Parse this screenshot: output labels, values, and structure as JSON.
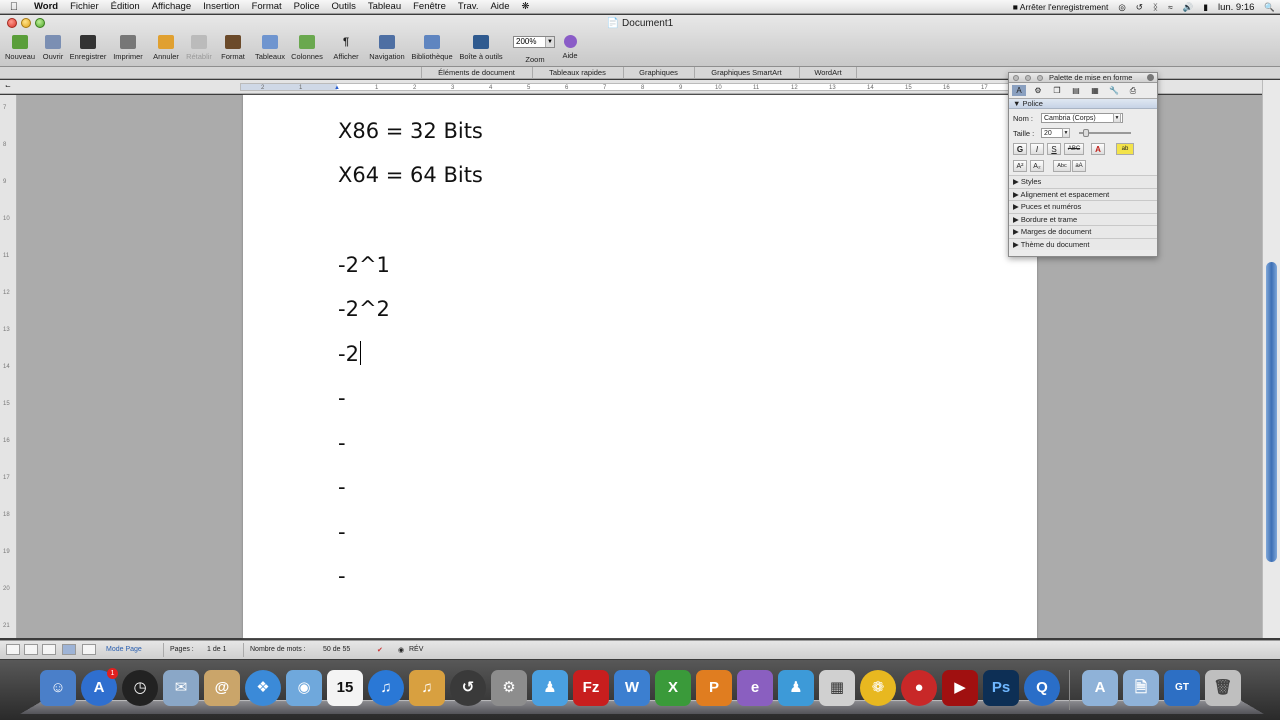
{
  "menubar": {
    "app": "Word",
    "items": [
      "Fichier",
      "Édition",
      "Affichage",
      "Insertion",
      "Format",
      "Police",
      "Outils",
      "Tableau",
      "Fenêtre",
      "Trav.",
      "Aide"
    ],
    "recording": "Arrêter l'enregistrement",
    "clock": "lun. 9:16"
  },
  "window": {
    "title": "Document1"
  },
  "toolbar": {
    "nouveau": "Nouveau",
    "ouvrir": "Ouvrir",
    "enregistrer": "Enregistrer",
    "imprimer": "Imprimer",
    "annuler": "Annuler",
    "retablir": "Rétablir",
    "format": "Format",
    "tableaux": "Tableaux",
    "colonnes": "Colonnes",
    "afficher": "Afficher",
    "navigation": "Navigation",
    "bibliotheque": "Bibliothèque",
    "boite": "Boîte à outils",
    "zoom_label": "Zoom",
    "zoom_value": "200%",
    "aide": "Aide"
  },
  "gallery": {
    "tabs": [
      "Éléments de document",
      "Tableaux rapides",
      "Graphiques",
      "Graphiques SmartArt",
      "WordArt"
    ]
  },
  "ruler": {
    "marks": [
      "2",
      "1",
      "1",
      "2",
      "3",
      "4",
      "5",
      "6",
      "7",
      "8",
      "9",
      "10",
      "11",
      "12",
      "13",
      "14",
      "15",
      "16",
      "17"
    ]
  },
  "vruler": {
    "marks": [
      "7",
      "8",
      "9",
      "10",
      "11",
      "12",
      "13",
      "14",
      "15",
      "16",
      "17",
      "18",
      "19",
      "20",
      "21"
    ]
  },
  "document": {
    "lines": [
      "X86 = 32 Bits",
      "X64 = 64 Bits",
      "-2^1",
      "-2^2",
      "-2",
      "-",
      "-",
      "-",
      "-",
      "-"
    ]
  },
  "palette": {
    "title": "Palette de mise en forme",
    "section_police": "Police",
    "nom_label": "Nom :",
    "nom_value": "Cambria (Corps)",
    "taille_label": "Taille :",
    "taille_value": "20",
    "bold": "G",
    "italic": "I",
    "strike": "S",
    "abc": "ABC",
    "sections": [
      "Styles",
      "Alignement et espacement",
      "Puces et numéros",
      "Bordure et trame",
      "Marges de document",
      "Thème du document"
    ]
  },
  "statusbar": {
    "mode": "Mode Page",
    "pages_label": "Pages :",
    "pages_value": "1 de 1",
    "words_label": "Nombre de mots :",
    "words_value": "50 de 55",
    "rev": "RÉV"
  },
  "dock": {
    "badge": "1",
    "calendar_day": "15",
    "ps_label": "Ps",
    "gt_label": "GT"
  }
}
